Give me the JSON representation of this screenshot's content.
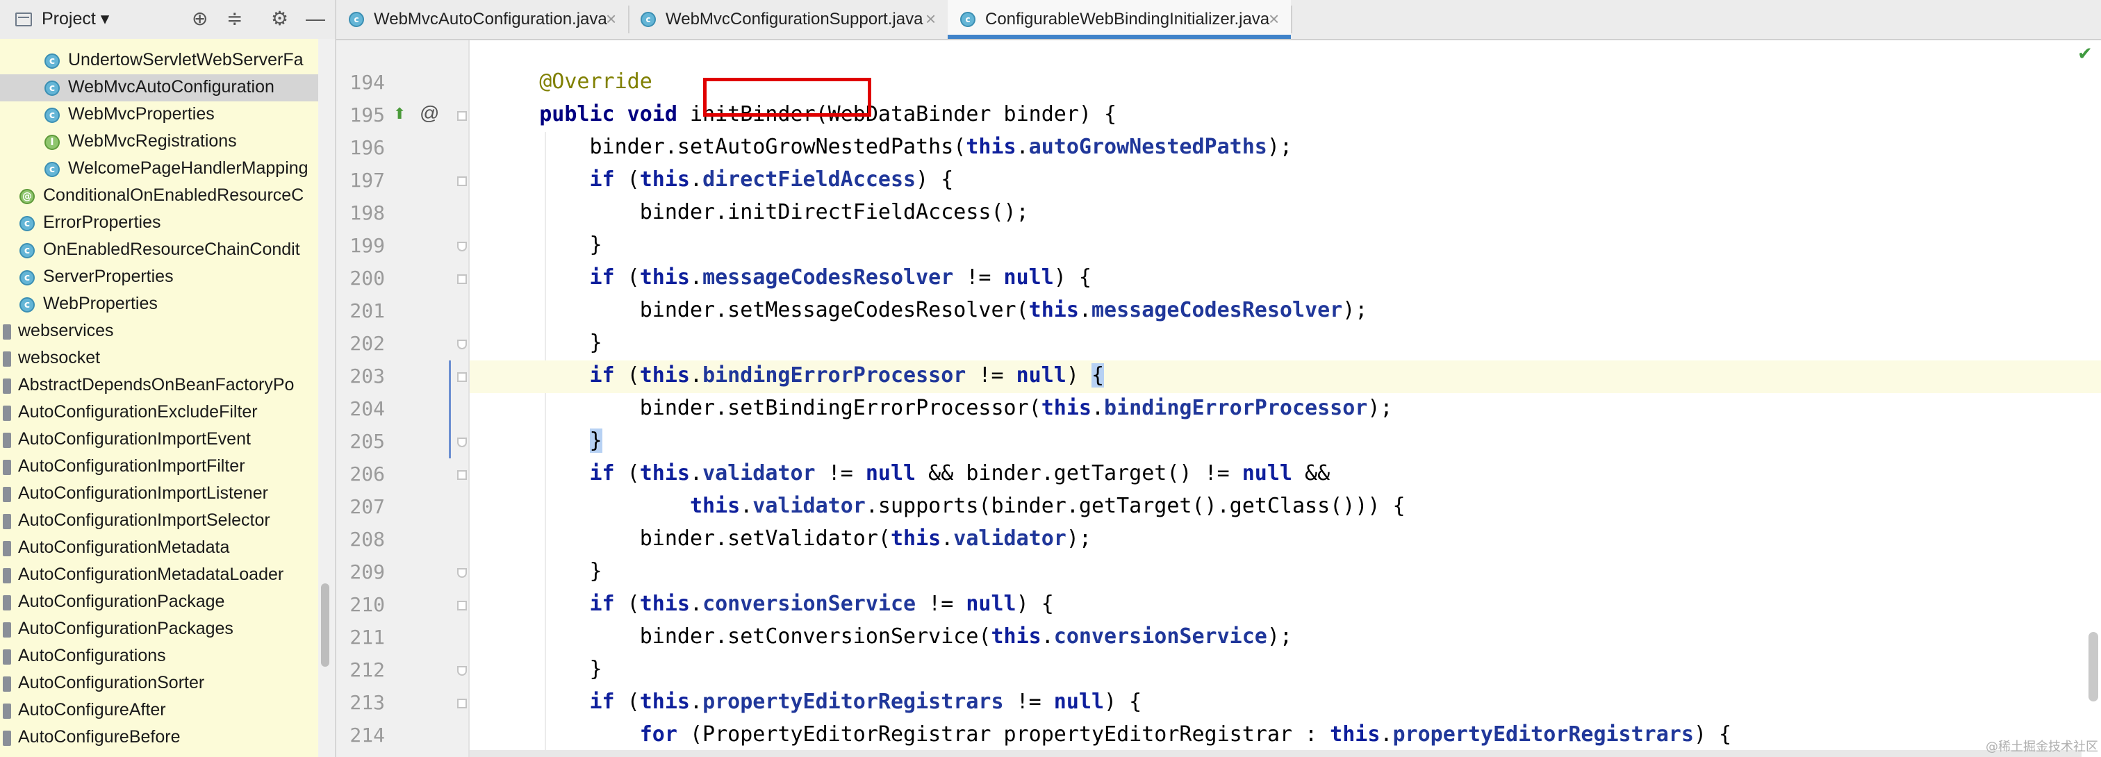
{
  "project_panel": {
    "title": "Project ▾",
    "tree": [
      {
        "label": "UndertowServletWebServerFa",
        "kind": "class"
      },
      {
        "label": "WebMvcAutoConfiguration",
        "kind": "class",
        "selected": true
      },
      {
        "label": "WebMvcProperties",
        "kind": "class"
      },
      {
        "label": "WebMvcRegistrations",
        "kind": "iface"
      },
      {
        "label": "WelcomePageHandlerMapping",
        "kind": "class"
      },
      {
        "label": "ConditionalOnEnabledResourceC",
        "kind": "annot"
      },
      {
        "label": "ErrorProperties",
        "kind": "class"
      },
      {
        "label": "OnEnabledResourceChainCondit",
        "kind": "class"
      },
      {
        "label": "ServerProperties",
        "kind": "class"
      },
      {
        "label": "WebProperties",
        "kind": "class"
      },
      {
        "label": "webservices",
        "kind": "pkg"
      },
      {
        "label": "websocket",
        "kind": "pkg"
      },
      {
        "label": "AbstractDependsOnBeanFactoryPo",
        "kind": "pkg"
      },
      {
        "label": "AutoConfigurationExcludeFilter",
        "kind": "pkg"
      },
      {
        "label": "AutoConfigurationImportEvent",
        "kind": "pkg"
      },
      {
        "label": "AutoConfigurationImportFilter",
        "kind": "pkg"
      },
      {
        "label": "AutoConfigurationImportListener",
        "kind": "pkg"
      },
      {
        "label": "AutoConfigurationImportSelector",
        "kind": "pkg"
      },
      {
        "label": "AutoConfigurationMetadata",
        "kind": "pkg"
      },
      {
        "label": "AutoConfigurationMetadataLoader",
        "kind": "pkg"
      },
      {
        "label": "AutoConfigurationPackage",
        "kind": "pkg"
      },
      {
        "label": "AutoConfigurationPackages",
        "kind": "pkg"
      },
      {
        "label": "AutoConfigurations",
        "kind": "pkg"
      },
      {
        "label": "AutoConfigurationSorter",
        "kind": "pkg"
      },
      {
        "label": "AutoConfigureAfter",
        "kind": "pkg"
      },
      {
        "label": "AutoConfigureBefore",
        "kind": "pkg"
      }
    ]
  },
  "tabs": [
    {
      "label": "WebMvcAutoConfiguration.java",
      "active": false
    },
    {
      "label": "WebMvcConfigurationSupport.java",
      "active": false
    },
    {
      "label": "ConfigurableWebBindingInitializer.java",
      "active": true
    }
  ],
  "editor": {
    "current_line": "203",
    "lines": [
      {
        "num": "194",
        "tokens": [
          {
            "t": "    ",
            "c": "txt"
          },
          {
            "t": "@Override",
            "c": "ann"
          }
        ]
      },
      {
        "num": "195",
        "tokens": [
          {
            "t": "    ",
            "c": "txt"
          },
          {
            "t": "public void",
            "c": "kw2"
          },
          {
            "t": " initBinder",
            "c": "txt"
          },
          {
            "t": "(WebDataBinder binder) {",
            "c": "txt"
          }
        ]
      },
      {
        "num": "196",
        "tokens": [
          {
            "t": "        binder.setAutoGrowNestedPaths(",
            "c": "txt"
          },
          {
            "t": "this",
            "c": "kw"
          },
          {
            "t": ".",
            "c": "txt"
          },
          {
            "t": "autoGrowNestedPaths",
            "c": "fldb"
          },
          {
            "t": ");",
            "c": "txt"
          }
        ]
      },
      {
        "num": "197",
        "tokens": [
          {
            "t": "        ",
            "c": "txt"
          },
          {
            "t": "if",
            "c": "kw"
          },
          {
            "t": " (",
            "c": "txt"
          },
          {
            "t": "this",
            "c": "kw"
          },
          {
            "t": ".",
            "c": "txt"
          },
          {
            "t": "directFieldAccess",
            "c": "fldb"
          },
          {
            "t": ") {",
            "c": "txt"
          }
        ]
      },
      {
        "num": "198",
        "tokens": [
          {
            "t": "            binder.initDirectFieldAccess();",
            "c": "txt"
          }
        ]
      },
      {
        "num": "199",
        "tokens": [
          {
            "t": "        }",
            "c": "txt"
          }
        ]
      },
      {
        "num": "200",
        "tokens": [
          {
            "t": "        ",
            "c": "txt"
          },
          {
            "t": "if",
            "c": "kw"
          },
          {
            "t": " (",
            "c": "txt"
          },
          {
            "t": "this",
            "c": "kw"
          },
          {
            "t": ".",
            "c": "txt"
          },
          {
            "t": "messageCodesResolver",
            "c": "fldb"
          },
          {
            "t": " != ",
            "c": "txt"
          },
          {
            "t": "null",
            "c": "kw"
          },
          {
            "t": ") {",
            "c": "txt"
          }
        ]
      },
      {
        "num": "201",
        "tokens": [
          {
            "t": "            binder.setMessageCodesResolver(",
            "c": "txt"
          },
          {
            "t": "this",
            "c": "kw"
          },
          {
            "t": ".",
            "c": "txt"
          },
          {
            "t": "messageCodesResolver",
            "c": "fldb"
          },
          {
            "t": ");",
            "c": "txt"
          }
        ]
      },
      {
        "num": "202",
        "tokens": [
          {
            "t": "        }",
            "c": "txt"
          }
        ]
      },
      {
        "num": "203",
        "tokens": [
          {
            "t": "        ",
            "c": "txt"
          },
          {
            "t": "if",
            "c": "kw"
          },
          {
            "t": " (",
            "c": "txt"
          },
          {
            "t": "this",
            "c": "kw"
          },
          {
            "t": ".",
            "c": "txt"
          },
          {
            "t": "bindingErrorProcessor",
            "c": "fldb"
          },
          {
            "t": " != ",
            "c": "txt"
          },
          {
            "t": "null",
            "c": "kw"
          },
          {
            "t": ") ",
            "c": "txt"
          },
          {
            "t": "{",
            "c": "txt",
            "hl": true
          }
        ]
      },
      {
        "num": "204",
        "tokens": [
          {
            "t": "            binder.setBindingErrorProcessor(",
            "c": "txt"
          },
          {
            "t": "this",
            "c": "kw"
          },
          {
            "t": ".",
            "c": "txt"
          },
          {
            "t": "bindingErrorProcessor",
            "c": "fldb"
          },
          {
            "t": ");",
            "c": "txt"
          }
        ]
      },
      {
        "num": "205",
        "tokens": [
          {
            "t": "        ",
            "c": "txt"
          },
          {
            "t": "}",
            "c": "txt",
            "hl": true
          }
        ]
      },
      {
        "num": "206",
        "tokens": [
          {
            "t": "        ",
            "c": "txt"
          },
          {
            "t": "if",
            "c": "kw"
          },
          {
            "t": " (",
            "c": "txt"
          },
          {
            "t": "this",
            "c": "kw"
          },
          {
            "t": ".",
            "c": "txt"
          },
          {
            "t": "validator",
            "c": "fldb"
          },
          {
            "t": " != ",
            "c": "txt"
          },
          {
            "t": "null",
            "c": "kw"
          },
          {
            "t": " && binder.getTarget() != ",
            "c": "txt"
          },
          {
            "t": "null",
            "c": "kw"
          },
          {
            "t": " &&",
            "c": "txt"
          }
        ]
      },
      {
        "num": "207",
        "tokens": [
          {
            "t": "                ",
            "c": "txt"
          },
          {
            "t": "this",
            "c": "kw"
          },
          {
            "t": ".",
            "c": "txt"
          },
          {
            "t": "validator",
            "c": "fldb"
          },
          {
            "t": ".supports(binder.getTarget().getClass())) {",
            "c": "txt"
          }
        ]
      },
      {
        "num": "208",
        "tokens": [
          {
            "t": "            binder.setValidator(",
            "c": "txt"
          },
          {
            "t": "this",
            "c": "kw"
          },
          {
            "t": ".",
            "c": "txt"
          },
          {
            "t": "validator",
            "c": "fldb"
          },
          {
            "t": ");",
            "c": "txt"
          }
        ]
      },
      {
        "num": "209",
        "tokens": [
          {
            "t": "        }",
            "c": "txt"
          }
        ]
      },
      {
        "num": "210",
        "tokens": [
          {
            "t": "        ",
            "c": "txt"
          },
          {
            "t": "if",
            "c": "kw"
          },
          {
            "t": " (",
            "c": "txt"
          },
          {
            "t": "this",
            "c": "kw"
          },
          {
            "t": ".",
            "c": "txt"
          },
          {
            "t": "conversionService",
            "c": "fldb"
          },
          {
            "t": " != ",
            "c": "txt"
          },
          {
            "t": "null",
            "c": "kw"
          },
          {
            "t": ") {",
            "c": "txt"
          }
        ]
      },
      {
        "num": "211",
        "tokens": [
          {
            "t": "            binder.setConversionService(",
            "c": "txt"
          },
          {
            "t": "this",
            "c": "kw"
          },
          {
            "t": ".",
            "c": "txt"
          },
          {
            "t": "conversionService",
            "c": "fldb"
          },
          {
            "t": ");",
            "c": "txt"
          }
        ]
      },
      {
        "num": "212",
        "tokens": [
          {
            "t": "        }",
            "c": "txt"
          }
        ]
      },
      {
        "num": "213",
        "tokens": [
          {
            "t": "        ",
            "c": "txt"
          },
          {
            "t": "if",
            "c": "kw"
          },
          {
            "t": " (",
            "c": "txt"
          },
          {
            "t": "this",
            "c": "kw"
          },
          {
            "t": ".",
            "c": "txt"
          },
          {
            "t": "propertyEditorRegistrars",
            "c": "fldb"
          },
          {
            "t": " != ",
            "c": "txt"
          },
          {
            "t": "null",
            "c": "kw"
          },
          {
            "t": ") {",
            "c": "txt"
          }
        ]
      },
      {
        "num": "214",
        "tokens": [
          {
            "t": "            ",
            "c": "txt"
          },
          {
            "t": "for",
            "c": "kw"
          },
          {
            "t": " (PropertyEditorRegistrar propertyEditorRegistrar : ",
            "c": "txt"
          },
          {
            "t": "this",
            "c": "kw"
          },
          {
            "t": ".",
            "c": "txt"
          },
          {
            "t": "propertyEditorRegistrars",
            "c": "fldb"
          },
          {
            "t": ") {",
            "c": "txt"
          }
        ]
      }
    ]
  },
  "watermark": "@稀土掘金技术社区",
  "colors": {
    "accent": "#4083c9",
    "highlight_box": "#e00000",
    "tree_bg": "#fcfbd8"
  }
}
